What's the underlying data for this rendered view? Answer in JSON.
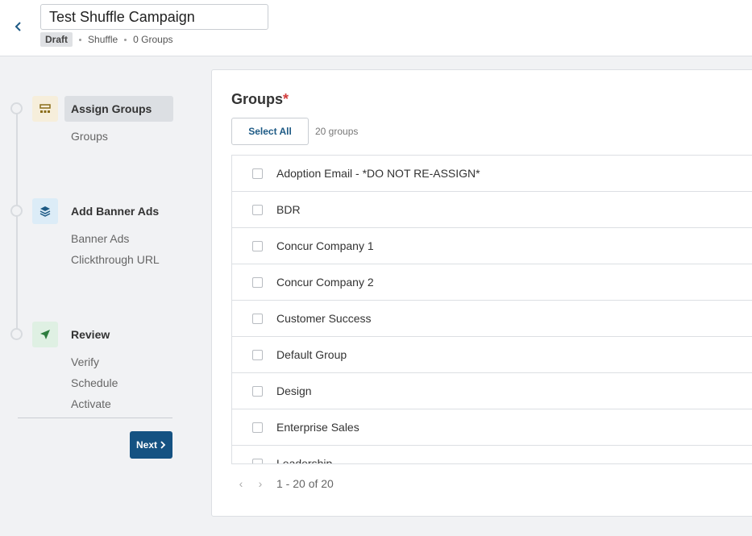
{
  "header": {
    "campaign_name": "Test Shuffle Campaign",
    "status_badge": "Draft",
    "type_label": "Shuffle",
    "groups_count_label": "0 Groups"
  },
  "stepper": {
    "steps": [
      {
        "title": "Assign Groups",
        "icon": "groups-icon",
        "icon_bg": "#f6eedb",
        "icon_color": "#8a6d1a",
        "active": true,
        "subs": [
          "Groups"
        ]
      },
      {
        "title": "Add Banner Ads",
        "icon": "layers-icon",
        "icon_bg": "#dcecf7",
        "icon_color": "#1d5a85",
        "active": false,
        "subs": [
          "Banner Ads",
          "Clickthrough URL"
        ]
      },
      {
        "title": "Review",
        "icon": "send-icon",
        "icon_bg": "#dff0e3",
        "icon_color": "#2e7d3f",
        "active": false,
        "subs": [
          "Verify",
          "Schedule",
          "Activate"
        ]
      }
    ],
    "next_label": "Next"
  },
  "groups_panel": {
    "title": "Groups",
    "required_mark": "*",
    "select_all_label": "Select All",
    "count_label": "20 groups",
    "items": [
      "Adoption Email - *DO NOT RE-ASSIGN*",
      "BDR",
      "Concur Company 1",
      "Concur Company 2",
      "Customer Success",
      "Default Group",
      "Design",
      "Enterprise Sales",
      "Leadership"
    ],
    "pagination": "1 - 20 of 20"
  },
  "colors": {
    "primary": "#155282",
    "required": "#d23c3c"
  }
}
